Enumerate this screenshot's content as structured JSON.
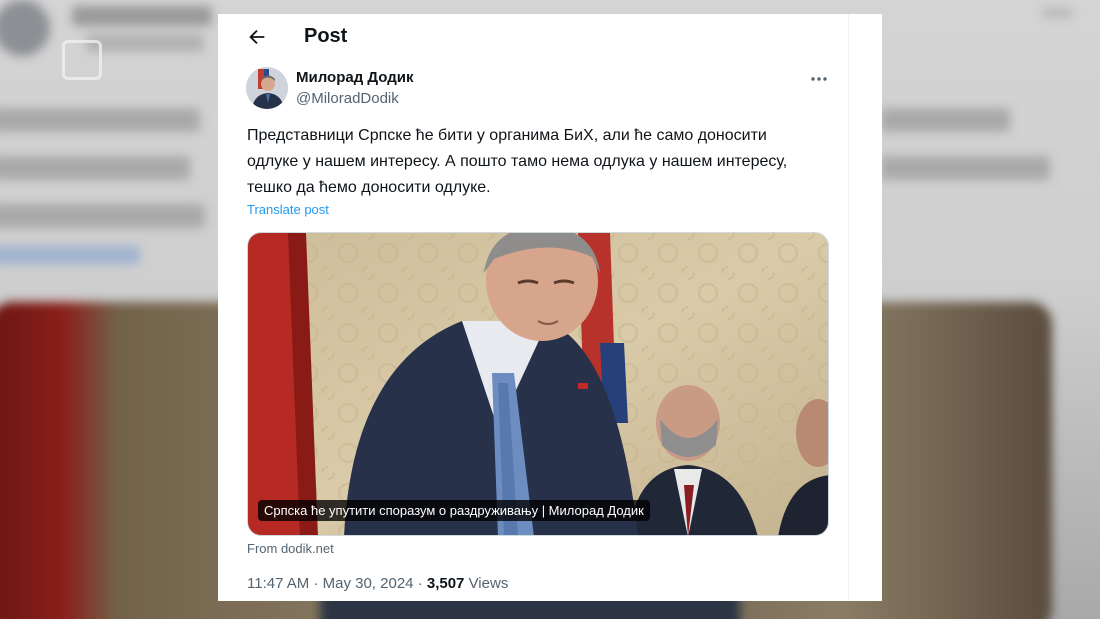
{
  "background": {
    "description_color": "#c9c9c9"
  },
  "header": {
    "title": "Post",
    "back_icon": "arrow-left-icon"
  },
  "author": {
    "name": "Милорад Додик",
    "handle": "@MiloradDodik",
    "avatar_icon": "profile-photo",
    "more_icon": "ellipsis-icon"
  },
  "tweet": {
    "lines": [
      "Представници Српске ће бити у органима БиХ, али ће само доносити",
      "одлуке у нашем интересу. А пошто тамо нема одлука у нашем интересу,",
      "тешко да ћемо доносити одлуке."
    ],
    "translate_label": "Translate post"
  },
  "media": {
    "caption": "Српска ће упутити споразум о раздруживању | Милорад Додик",
    "source": "From dodik.net"
  },
  "meta": {
    "time": "11:47 AM",
    "separator": "·",
    "date": "May 30, 2024",
    "views_count": "3,507",
    "views_label": "Views"
  },
  "colors": {
    "text_primary": "#0f1419",
    "text_secondary": "#536471",
    "link": "#1d9bf0",
    "card_bg": "#ffffff"
  }
}
